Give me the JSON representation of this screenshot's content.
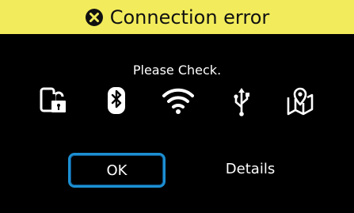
{
  "dialog": {
    "title": "Connection error",
    "message": "Please Check.",
    "icons": [
      "phone-lock-icon",
      "bluetooth-icon",
      "wifi-icon",
      "usb-icon",
      "map-pin-icon"
    ],
    "ok_label": "OK",
    "details_label": "Details"
  },
  "colors": {
    "title_bar": "#f2ec5c",
    "background": "#000000",
    "focus_border": "#1c8fd2"
  }
}
